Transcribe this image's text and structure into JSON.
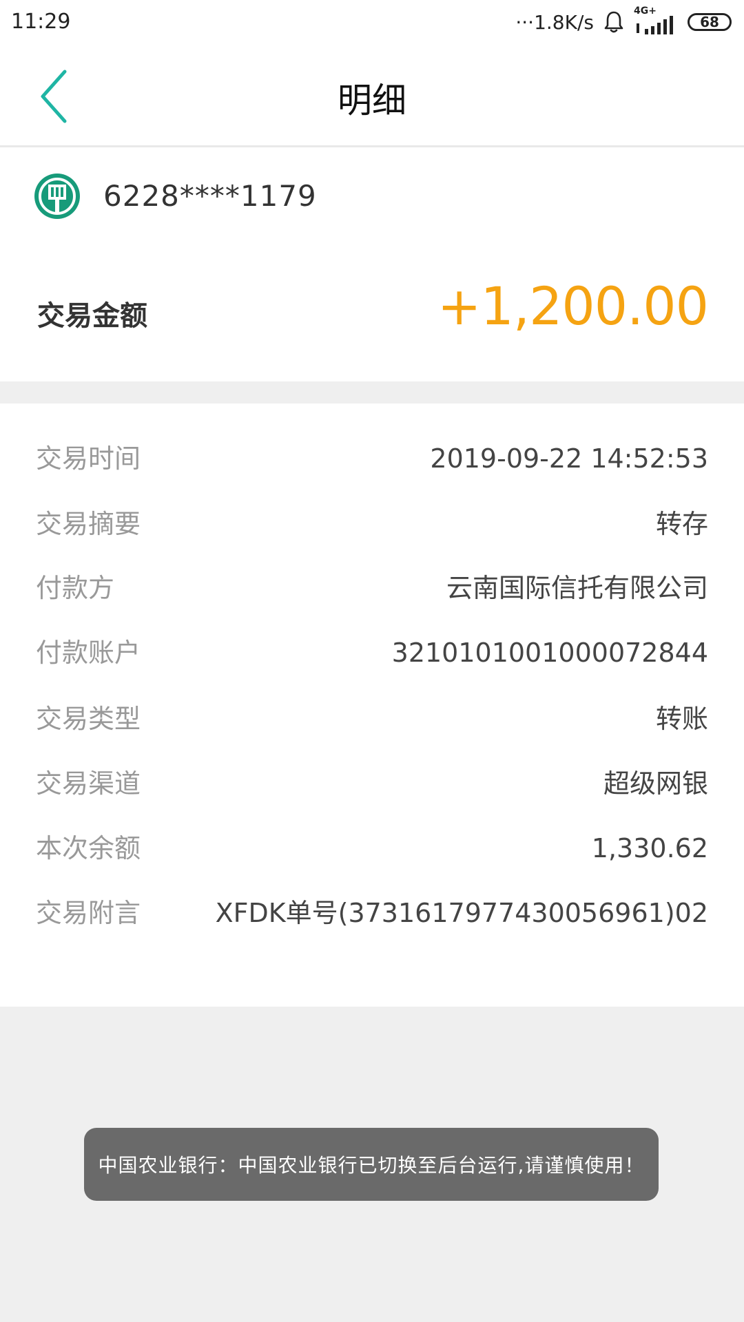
{
  "status_bar": {
    "time": "11:29",
    "net_speed": "···1.8K/s",
    "net_type": "4G+",
    "battery": "68"
  },
  "header": {
    "title": "明细"
  },
  "account": {
    "card_number": "6228****1179",
    "amount_label": "交易金额",
    "amount_value": "+1,200.00"
  },
  "details": [
    {
      "label": "交易时间",
      "value": "2019-09-22 14:52:53"
    },
    {
      "label": "交易摘要",
      "value": "转存"
    },
    {
      "label": "付款方",
      "value": "云南国际信托有限公司"
    },
    {
      "label": "付款账户",
      "value": "3210101001000072844"
    },
    {
      "label": "交易类型",
      "value": "转账"
    },
    {
      "label": "交易渠道",
      "value": "超级网银"
    },
    {
      "label": "本次余额",
      "value": "1,330.62"
    },
    {
      "label": "交易附言",
      "value": "XFDK单号(3731617977430056961)02"
    }
  ],
  "toast": {
    "text": "中国农业银行：中国农业银行已切换至后台运行,请谨慎使用！"
  },
  "colors": {
    "accent": "#1fb5a4",
    "amount": "#f5a312",
    "bank_logo": "#179b7a"
  }
}
